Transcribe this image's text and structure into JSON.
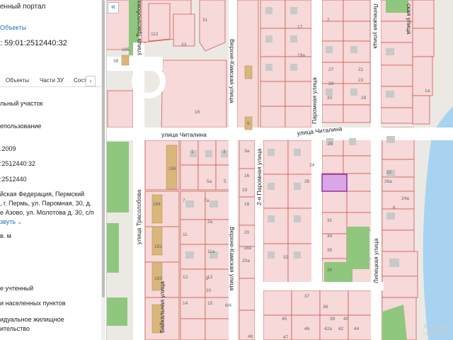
{
  "panel": {
    "portal_title": "енный портал",
    "objects_link": "Объекты",
    "cadastral_number": ": 59:01:2512440:32",
    "tabs": [
      "Объекты",
      "Части ЗУ",
      "Соста"
    ],
    "tab_more": "›",
    "land_plot_type": "льный участок",
    "usage_label": "епользование",
    "date_value": ".2009",
    "cad_number_short": ":2512440:32",
    "cad_quarter": ":2512440",
    "address_line1": "йская Федерация, Пермский",
    "address_line2": ", г. Пермь, ул. Паромная, 30, д.",
    "address_line3": "е Азово, ул. Молотова д. 30, с/п",
    "expand_link": "звуть",
    "area_unit": "в. м",
    "status_label": "е учтенный",
    "category_label": "и населенных пунктов",
    "permitted_use_line1": "идуальное жилищное",
    "permitted_use_line2": "ительство"
  },
  "map": {
    "collapse_label": "«",
    "streets": {
      "chitalina_left": "улица Читалина",
      "chitalina_right": "улица Читалина",
      "trasolobova_top": "улица Трасолобова",
      "trasolobova_bottom": "улица Трасолобова",
      "verkhne_kamskaya_top": "Верхне-Камская улица",
      "verkhne_kamskaya_bottom": "Верхне-Камская улица",
      "paromnaya": "Паромная улица",
      "paromnaya_2": "2-я Паромная улица",
      "lipetskaya_top": "Липецкая улица",
      "lipetskaya_bottom": "Липецкая улица",
      "baikalnaya": "Байкальная улица",
      "top_right_street": "ская улица"
    },
    "parcel_numbers": [
      "112",
      "31",
      "33",
      "185",
      "184",
      "38",
      "16",
      "3",
      "1",
      "2",
      "5",
      "6",
      "3a",
      "7",
      "7a",
      "11",
      "11a",
      "12",
      "13",
      "14",
      "15",
      "16",
      "18",
      "20",
      "22",
      "24",
      "25",
      "26",
      "27",
      "28",
      "29",
      "30",
      "31",
      "32",
      "34",
      "35",
      "36",
      "37",
      "38",
      "39",
      "40",
      "42",
      "44",
      "45",
      "46",
      "47",
      "48",
      "1a",
      "2a",
      "18a",
      "19",
      "20a",
      "8",
      "9",
      "10",
      "186",
      "182",
      "183",
      "6/4",
      "5a",
      "42a",
      "21",
      "23",
      "17",
      "19a",
      "26a",
      "24a"
    ],
    "watermark_line1": "Активац",
    "watermark_line2": "чтобы акти"
  }
}
